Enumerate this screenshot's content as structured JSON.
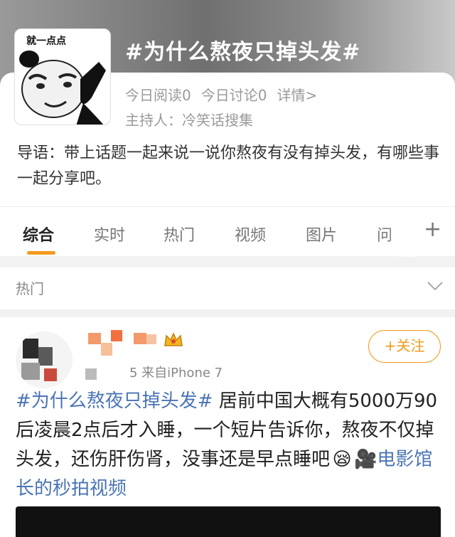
{
  "topic": {
    "title": "#为什么熬夜只掉头发#",
    "avatar_caption": "就一点点",
    "reads": "今日阅读0",
    "discussions": "今日讨论0",
    "details": "详情>",
    "host": "主持人：冷笑话搜集",
    "intro": "导语：带上话题一起来说一说你熬夜有没有掉头发，有哪些事一起分享吧。"
  },
  "tabs": [
    {
      "label": "综合"
    },
    {
      "label": "实时"
    },
    {
      "label": "热门"
    },
    {
      "label": "视频"
    },
    {
      "label": "图片"
    },
    {
      "label": "问"
    }
  ],
  "section": {
    "label": "热门"
  },
  "post": {
    "meta": "5 来自iPhone 7",
    "follow_label": "+关注",
    "hashtag": "#为什么熬夜只掉头发#",
    "body": " 居前中国大概有5000万90后凌晨2点后才入睡，一个短片告诉你，熬夜不仅掉头发，还伤肝伤肾，没事还是早点睡吧",
    "link_prefix": "🎥",
    "link_text": "电影馆长的秒拍视频"
  },
  "colors": {
    "accent": "#f39a1c",
    "link": "#4a74b5"
  }
}
